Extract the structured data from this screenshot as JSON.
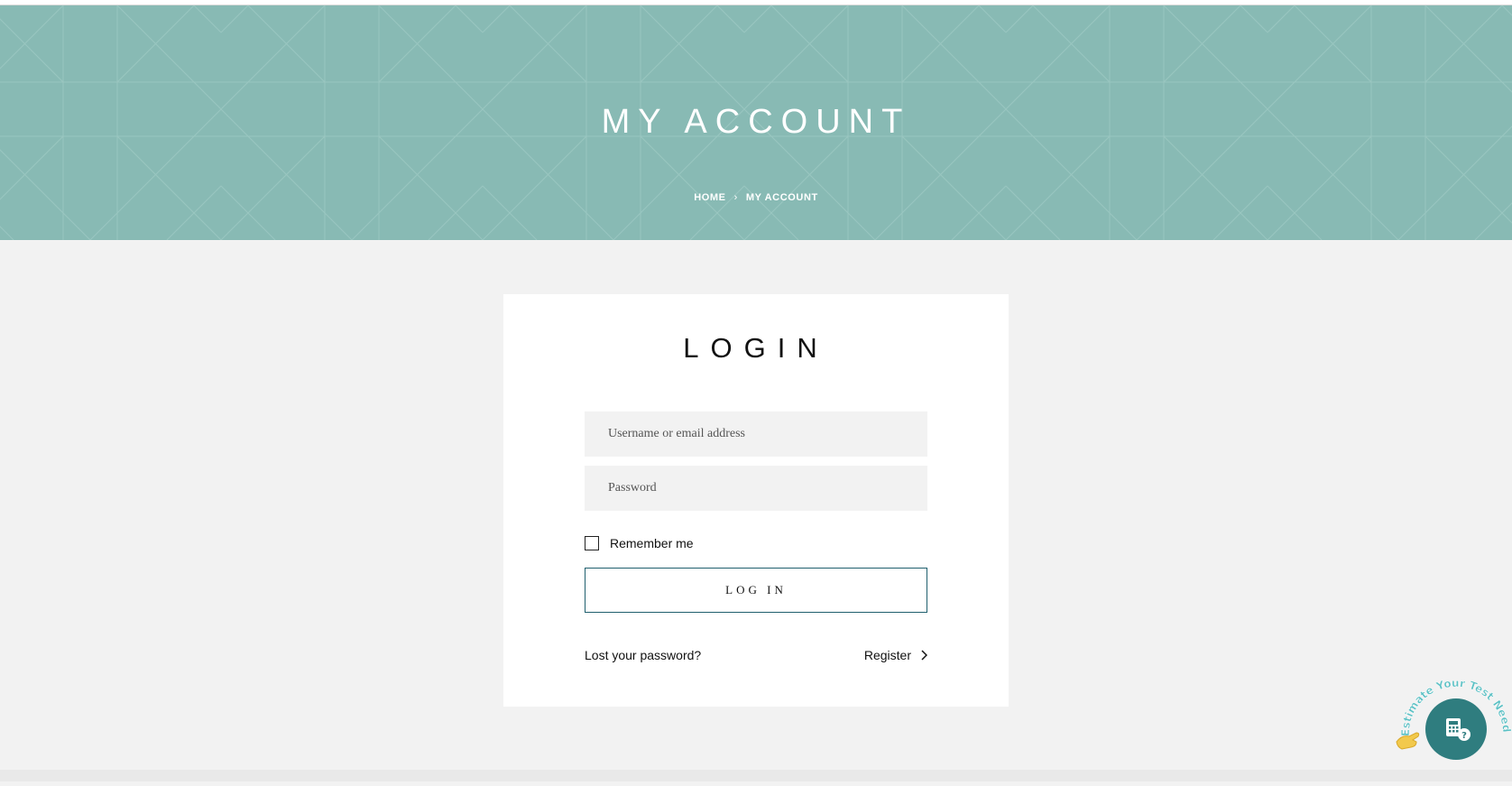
{
  "hero": {
    "title": "MY ACCOUNT",
    "breadcrumb": {
      "home": "HOME",
      "separator": "›",
      "current": "MY ACCOUNT"
    },
    "background_color": "#88bab4"
  },
  "login": {
    "title": "LOGIN",
    "username_placeholder": "Username or email address",
    "password_placeholder": "Password",
    "remember_label": "Remember me",
    "remember_checked": false,
    "submit_label": "LOG IN",
    "lost_password_label": "Lost your password?",
    "register_label": "Register"
  },
  "widget": {
    "label": "Estimate Your Test Needs",
    "icon": "calculator-question-icon",
    "hand_icon": "pointing-hand-icon",
    "color": "#2f7d7f",
    "accent": "#f2c94c"
  },
  "icons": {
    "register_chevron": "chevron-right-icon"
  }
}
